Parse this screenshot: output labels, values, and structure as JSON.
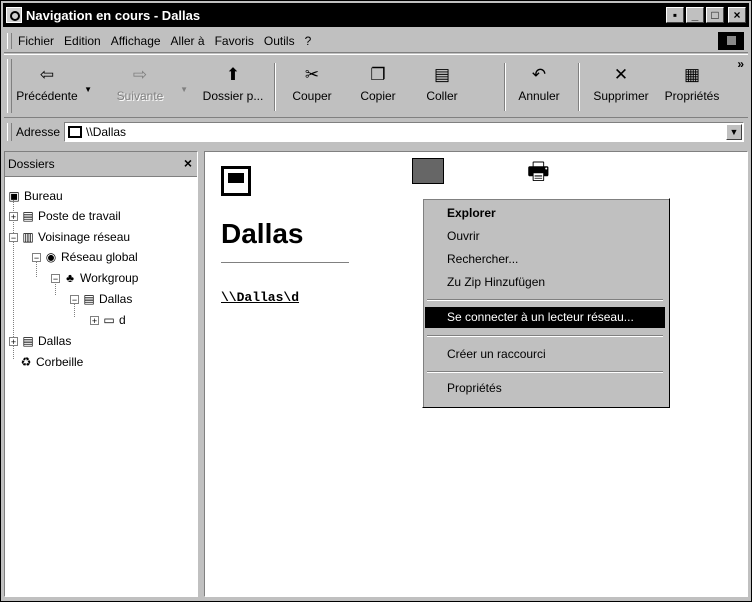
{
  "window": {
    "title": "Navigation en cours - Dallas"
  },
  "menubar": {
    "items": [
      "Fichier",
      "Edition",
      "Affichage",
      "Aller à",
      "Favoris",
      "Outils",
      "?"
    ]
  },
  "toolbar": {
    "buttons": [
      {
        "label": "Précédente",
        "icon": "back-arrow-icon"
      },
      {
        "label": "Suivante",
        "icon": "forward-arrow-icon",
        "disabled": true
      },
      {
        "label": "Dossier p...",
        "icon": "folder-up-icon"
      },
      {
        "label": "Couper",
        "icon": "scissors-icon"
      },
      {
        "label": "Copier",
        "icon": "copy-icon"
      },
      {
        "label": "Coller",
        "icon": "paste-icon"
      },
      {
        "label": "Annuler",
        "icon": "undo-icon"
      },
      {
        "label": "Supprimer",
        "icon": "delete-x-icon"
      },
      {
        "label": "Propriétés",
        "icon": "properties-icon"
      }
    ],
    "overflow": "»"
  },
  "address": {
    "label": "Adresse",
    "value": "\\\\Dallas"
  },
  "folders": {
    "header": "Dossiers",
    "close": "×",
    "tree": [
      {
        "label": "Bureau",
        "icon": "desktop-icon"
      },
      {
        "label": "Poste de travail",
        "icon": "computer-icon"
      },
      {
        "label": "Voisinage réseau",
        "icon": "network-neighborhood-icon"
      },
      {
        "label": "Réseau global",
        "icon": "globe-network-icon"
      },
      {
        "label": "Workgroup",
        "icon": "workgroup-icon"
      },
      {
        "label": "Dallas",
        "icon": "computer-icon"
      },
      {
        "label": "d",
        "icon": "folder-icon"
      },
      {
        "label": "Dallas",
        "icon": "computer-icon"
      },
      {
        "label": "Corbeille",
        "icon": "recycle-bin-icon"
      }
    ]
  },
  "content": {
    "title": "Dallas",
    "link": "\\\\Dallas\\d"
  },
  "context_menu": {
    "items": [
      "Explorer",
      "Ouvrir",
      "Rechercher...",
      "Zu Zip Hinzufügen",
      "Se connecter à un lecteur réseau...",
      "Créer un raccourci",
      "Propriétés"
    ],
    "selected": "Se connecter à un lecteur réseau..."
  }
}
